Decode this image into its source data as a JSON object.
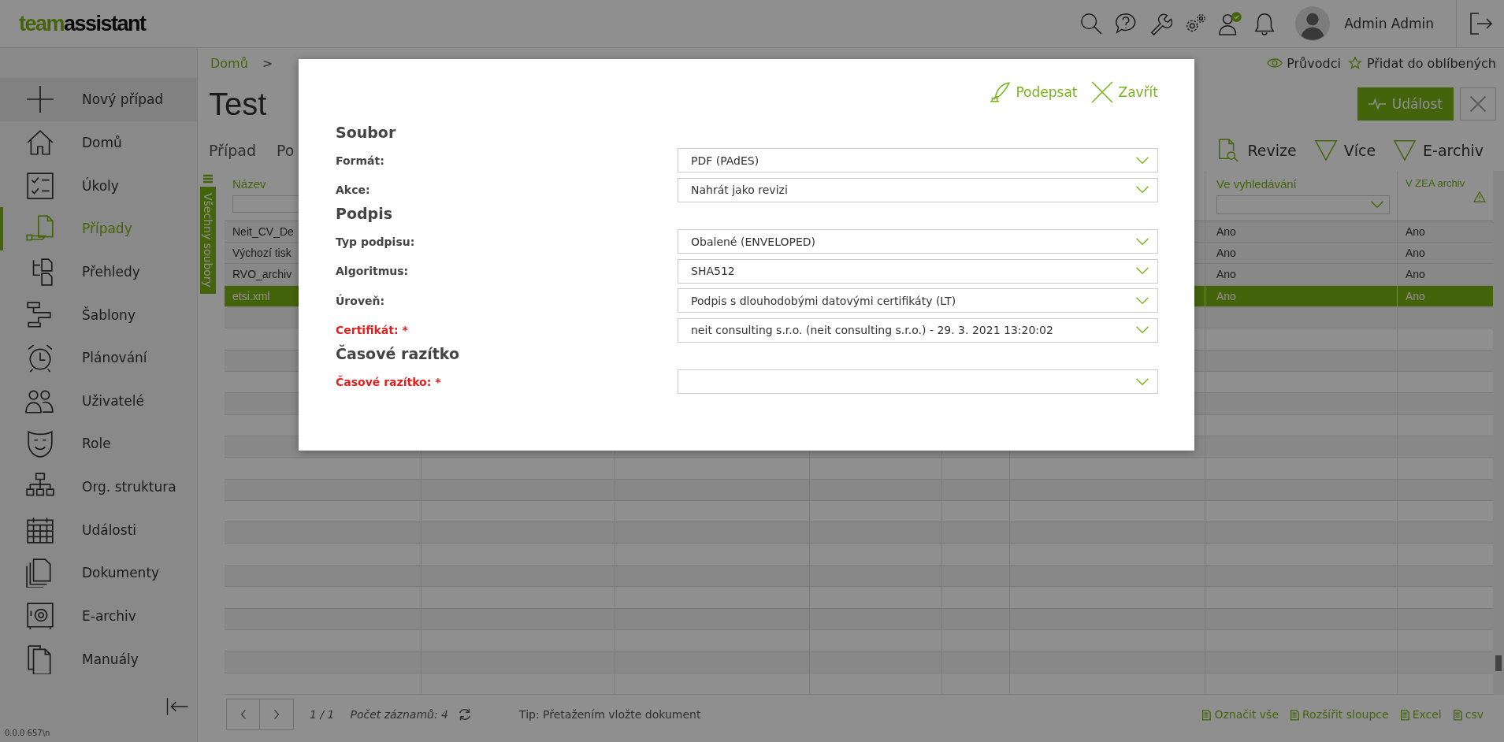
{
  "header": {
    "logo_part1": "team",
    "logo_part2": "assistant",
    "user_name": "Admin Admin"
  },
  "sidebar": {
    "items": [
      {
        "label": "Nový případ",
        "selected": false
      },
      {
        "label": "Domů",
        "selected": false
      },
      {
        "label": "Úkoly",
        "selected": false
      },
      {
        "label": "Případy",
        "selected": true
      },
      {
        "label": "Přehledy",
        "selected": false
      },
      {
        "label": "Šablony",
        "selected": false
      },
      {
        "label": "Plánování",
        "selected": false
      },
      {
        "label": "Uživatelé",
        "selected": false
      },
      {
        "label": "Role",
        "selected": false
      },
      {
        "label": "Org. struktura",
        "selected": false
      },
      {
        "label": "Události",
        "selected": false
      },
      {
        "label": "Dokumenty",
        "selected": false
      },
      {
        "label": "E-archiv",
        "selected": false
      },
      {
        "label": "Manuály",
        "selected": false
      }
    ],
    "version": "0.0.0 657\\n"
  },
  "breadcrumb": {
    "items": [
      "Domů"
    ],
    "separator": ">"
  },
  "page_links": [
    "Průvodci",
    "Přidat do oblíbených"
  ],
  "title": "Test",
  "event_button": "Událost",
  "tabs": [
    {
      "label": "Případ",
      "selected": false
    },
    {
      "label": "Po",
      "selected": false
    }
  ],
  "toolbar": [
    "Revize",
    "Více",
    "E-archiv"
  ],
  "side_tab": "Všechny soubory",
  "table": {
    "columns": [
      "Název",
      "Ve vyhledávání",
      "V ZEA archiv"
    ],
    "rows": [
      {
        "name": "Neit_CV_De",
        "in_search": "Ano",
        "in_zea": "Ano",
        "selected": false
      },
      {
        "name": "Výchozí tisk",
        "in_search": "Ano",
        "in_zea": "Ano",
        "selected": false
      },
      {
        "name": "RVO_archiv",
        "in_search": "Ano",
        "in_zea": "Ano",
        "selected": false
      },
      {
        "name": "etsi.xml",
        "in_search": "Ano",
        "in_zea": "Ano",
        "selected": true
      }
    ]
  },
  "footer": {
    "page": "1 / 1",
    "count": "Počet záznamů: 4",
    "tip": "Tip: Přetažením vložte dokument",
    "actions": [
      "Označit vše",
      "Rozšířit sloupce",
      "Excel",
      "csv"
    ]
  },
  "modal": {
    "actions": [
      "Podepsat",
      "Zavřít"
    ],
    "sections": [
      {
        "title": "Soubor",
        "fields": [
          {
            "label": "Formát:",
            "value": "PDF (PAdES)",
            "required": false
          },
          {
            "label": "Akce:",
            "value": "Nahrát jako revizi",
            "required": false
          }
        ]
      },
      {
        "title": "Podpis",
        "fields": [
          {
            "label": "Typ podpisu:",
            "value": "Obalené (ENVELOPED)",
            "required": false
          },
          {
            "label": "Algoritmus:",
            "value": "SHA512",
            "required": false
          },
          {
            "label": "Úroveň:",
            "value": "Podpis s dlouhodobými datovými certifikáty (LT)",
            "required": false
          },
          {
            "label": "Certifikát: *",
            "value": "neit consulting s.r.o. (neit consulting s.r.o.) - 29. 3. 2021 13:20:02",
            "required": true
          }
        ]
      },
      {
        "title": "Časové razítko",
        "fields": [
          {
            "label": "Časové razítko: *",
            "required": true
          }
        ]
      }
    ]
  }
}
